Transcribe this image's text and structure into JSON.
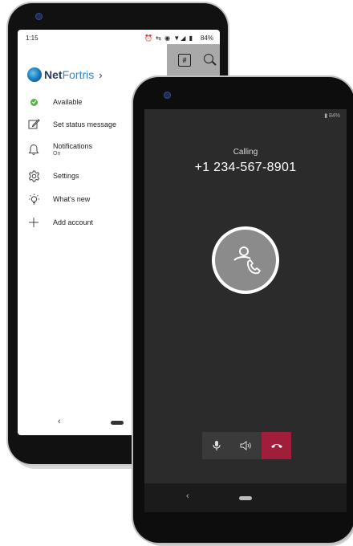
{
  "back_phone": {
    "status_bar": {
      "time": "1:15",
      "icons": "⏰ ⇆ ◉ ▼◢ ▮",
      "battery": "84%"
    },
    "header": {
      "brand_first": "Net",
      "brand_second": "Fortris",
      "chevron": "›",
      "action_icons": [
        "hashtag-icon",
        "search-icon"
      ]
    },
    "menu": [
      {
        "label": "Available",
        "icon": "available-status-icon"
      },
      {
        "label": "Set status message",
        "icon": "edit-status-icon"
      },
      {
        "label": "Notifications",
        "sublabel": "On",
        "icon": "bell-icon"
      },
      {
        "label": "Settings",
        "icon": "gear-icon"
      },
      {
        "label": "What's new",
        "icon": "lightbulb-icon"
      },
      {
        "label": "Add account",
        "icon": "plus-icon"
      }
    ],
    "nav": {
      "back": "‹"
    }
  },
  "front_phone": {
    "status_bar": {
      "battery": "84%"
    },
    "call": {
      "status": "Calling",
      "number": "+1 234-567-8901"
    },
    "controls": [
      "microphone-icon",
      "speaker-icon",
      "end-call-icon"
    ],
    "colors": {
      "end_call": "#a11d3c",
      "background": "#2b2b2b",
      "available": "#58b04a"
    },
    "nav": {
      "back": "‹"
    }
  }
}
